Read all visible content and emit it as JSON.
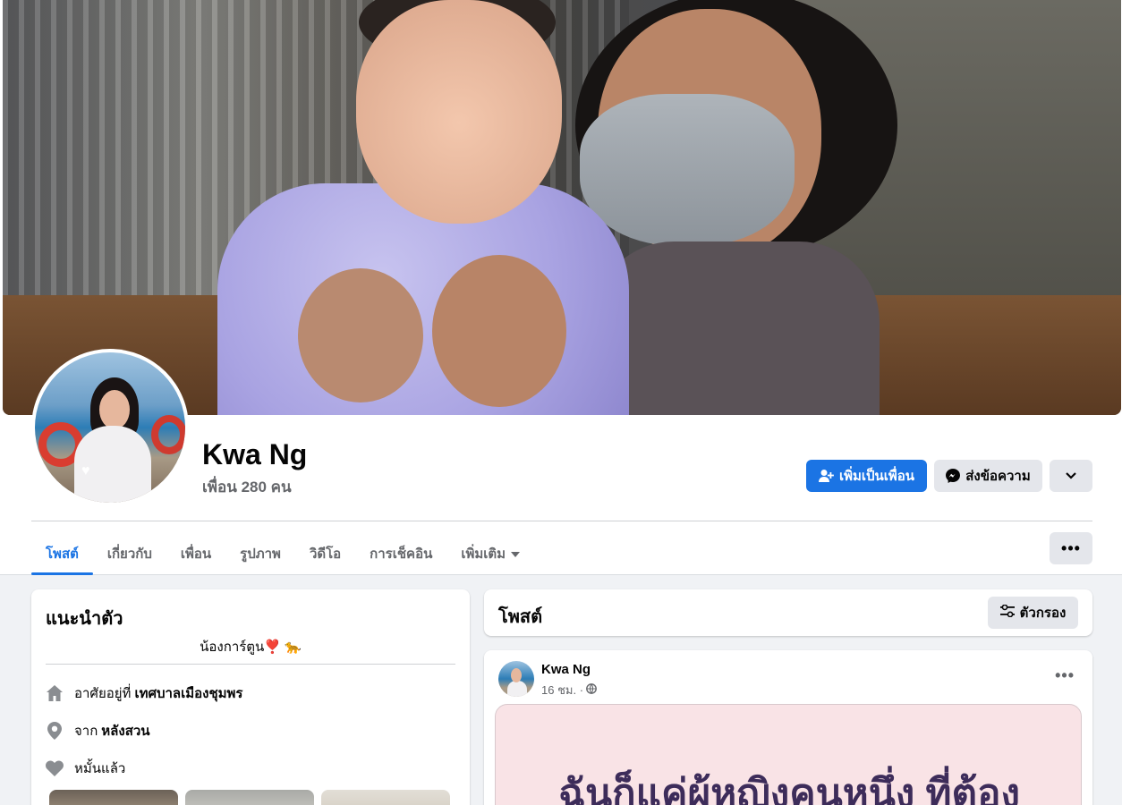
{
  "profile": {
    "name": "Kwa Ng",
    "friends_label": "เพื่อน 280 คน"
  },
  "actions": {
    "add_friend": "เพิ่มเป็นเพื่อน",
    "message": "ส่งข้อความ"
  },
  "tabs": [
    {
      "label": "โพสต์",
      "active": true
    },
    {
      "label": "เกี่ยวกับ"
    },
    {
      "label": "เพื่อน"
    },
    {
      "label": "รูปภาพ"
    },
    {
      "label": "วิดีโอ"
    },
    {
      "label": "การเช็คอิน"
    },
    {
      "label": "เพิ่มเติม"
    }
  ],
  "intro": {
    "title": "แนะนำตัว",
    "bio": "น้องการ์ตูน❣️ 🐆",
    "lives_prefix": "อาศัยอยู่ที่",
    "lives_value": "เทศบาลเมืองชุมพร",
    "from_prefix": "จาก",
    "from_value": "หลังสวน",
    "relationship": "หมั้นแล้ว"
  },
  "posts": {
    "title": "โพสต์",
    "filter_label": "ตัวกรอง"
  },
  "post": {
    "author": "Kwa Ng",
    "time": "16 ชม. ·",
    "image_text": "ฉันก็แค่ผู้หญิงคนหนึ่ง ที่ต้อง"
  },
  "colors": {
    "accent": "#1b74e4",
    "background": "#f0f2f5",
    "button_gray": "#e4e6eb",
    "muted_text": "#65676b"
  }
}
